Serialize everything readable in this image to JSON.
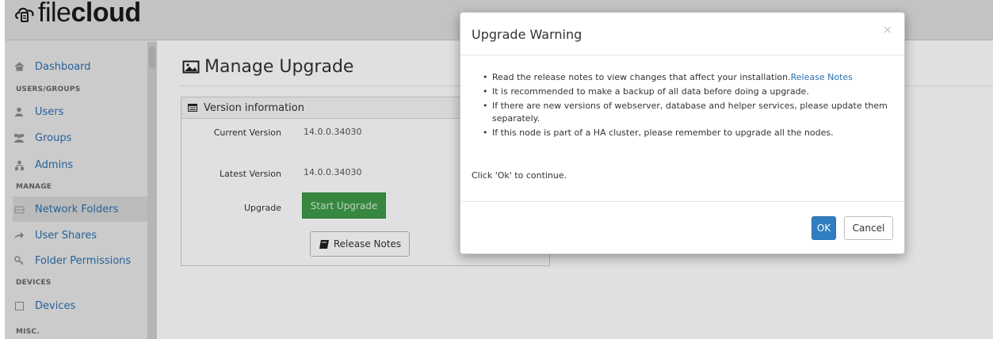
{
  "app": {
    "logo_text_light": "file",
    "logo_text_bold": "cloud"
  },
  "sidebar": {
    "items": [
      {
        "label": "Dashboard",
        "icon": "home-icon"
      },
      {
        "label": "Users",
        "icon": "user-icon"
      },
      {
        "label": "Groups",
        "icon": "users-icon"
      },
      {
        "label": "Admins",
        "icon": "sitemap-icon"
      },
      {
        "label": "Network Folders",
        "icon": "hdd-icon"
      },
      {
        "label": "User Shares",
        "icon": "share-icon"
      },
      {
        "label": "Folder Permissions",
        "icon": "key-icon"
      },
      {
        "label": "Devices",
        "icon": "checkbox-icon"
      }
    ],
    "sections": [
      "USERS/GROUPS",
      "MANAGE",
      "DEVICES",
      "MISC."
    ]
  },
  "main": {
    "title": "Manage Upgrade",
    "panel_title": "Version information",
    "current_version_label": "Current Version",
    "current_version_value": "14.0.0.34030",
    "latest_version_label": "Latest Version",
    "latest_version_value": "14.0.0.34030",
    "upgrade_label": "Upgrade",
    "start_upgrade_label": "Start Upgrade",
    "release_notes_label": "Release Notes"
  },
  "modal": {
    "title": "Upgrade Warning",
    "close_glyph": "×",
    "bullet_1_text": "Read the release notes to view changes that affect your installation.",
    "bullet_1_link": "Release Notes",
    "bullet_2": "It is recommended to make a backup of all data before doing a upgrade.",
    "bullet_3": "If there are new versions of webserver, database and helper services, please update them separately.",
    "bullet_4": "If this node is part of a HA cluster, please remember to upgrade all the nodes.",
    "continue_text": "Click 'Ok' to continue.",
    "ok_label": "OK",
    "cancel_label": "Cancel"
  },
  "colors": {
    "link": "#2c6fb0",
    "primary_button": "#2f7ec1",
    "success_button": "#3e9a48"
  }
}
